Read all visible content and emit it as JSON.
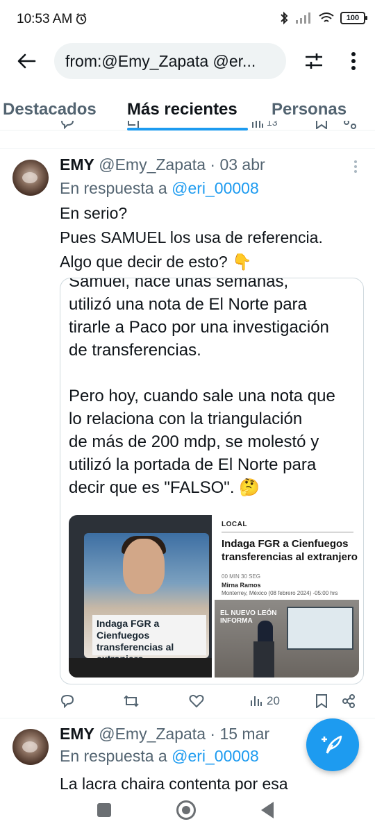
{
  "status_bar": {
    "time": "10:53 AM",
    "battery": "100"
  },
  "search": {
    "query": "from:@Emy_Zapata @er..."
  },
  "tabs": [
    {
      "label": "Destacados",
      "active": false
    },
    {
      "label": "Más recientes",
      "active": true
    },
    {
      "label": "Personas",
      "active": false
    }
  ],
  "prev_tweet": {
    "views": "13"
  },
  "tweets": [
    {
      "name": "EMY",
      "handle": "@Emy_Zapata",
      "separator": "·",
      "date": "03 abr",
      "reply_prefix": "En respuesta a",
      "reply_to": "@eri_00008",
      "text": "En serio?\nPues SAMUEL los usa de referencia.\nAlgo que decir de esto? 👇",
      "media": {
        "quote_text": "Samuel, hace unas semanas,\nutilizó una nota de El Norte para\ntirarle a Paco por una investigación\nde transferencias.\n\nPero hoy, cuando sale una nota que\nlo relaciona con la triangulación\nde más de 200 mdp, se molestó y\nutilizó la portada de El Norte para\ndecir que es \"FALSO\". 🤔",
        "left_caption": "Indaga FGR a Cienfuegos transferencias al extranjero",
        "right_label": "LOCAL",
        "right_title": "Indaga FGR a Cienfuegos\ntransferencias al extranjero",
        "right_meta": "00 MIN 30 SEG",
        "right_author": "Mirna Ramos",
        "right_date": "Monterrey, México (08 febrero 2024) -05:00 hrs",
        "right_logo": "EL NUEVO LEÓN\nINFORMA"
      },
      "views": "20"
    },
    {
      "name": "EMY",
      "handle": "@Emy_Zapata",
      "separator": "·",
      "date": "15 mar",
      "reply_prefix": "En respuesta a",
      "reply_to": "@eri_00008",
      "text": "La lacra chaira contenta por esa"
    }
  ],
  "colors": {
    "accent": "#1d9bf0",
    "secondary_text": "#536471",
    "border": "#cfd9de"
  },
  "icons": [
    "back-arrow-icon",
    "filter-sliders-icon",
    "more-vertical-icon",
    "reply-icon",
    "retweet-icon",
    "like-icon",
    "views-icon",
    "bookmark-icon",
    "share-icon",
    "compose-icon"
  ]
}
